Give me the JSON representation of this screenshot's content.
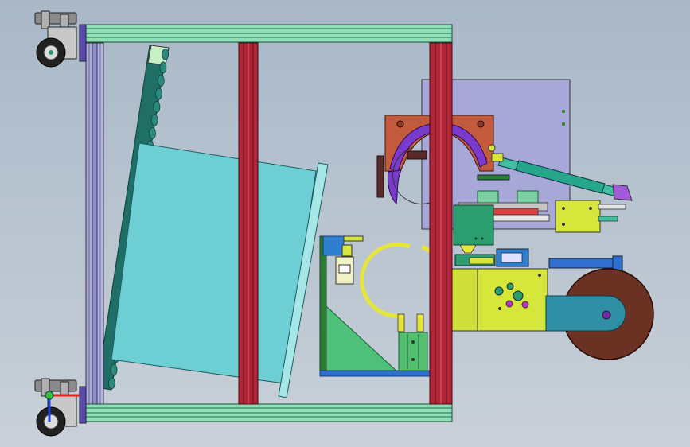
{
  "viewport": {
    "background_top": "#a9b8c8",
    "background_bottom": "#c9d0d8"
  },
  "colors": {
    "extrusion_green": "#8fe0b8",
    "upright_red": "#b3263a",
    "cyan_panel": "#6dcfd3",
    "lavender_plate": "#a7a7d8",
    "rust_clamp": "#c45a3c",
    "purple_arc": "#7a3acc",
    "yellow_block": "#d7e63a",
    "roller_brown": "#6b3223",
    "teal_arm": "#2f8fa5",
    "green_wedge": "#4fc07a",
    "blue_rod": "#2f6fd0",
    "dark_green_block": "#2a9e6f"
  },
  "icons": {
    "caster_top": "caster-wheel-icon",
    "caster_bottom": "caster-wheel-icon",
    "triad": "coordinate-triad-icon"
  }
}
